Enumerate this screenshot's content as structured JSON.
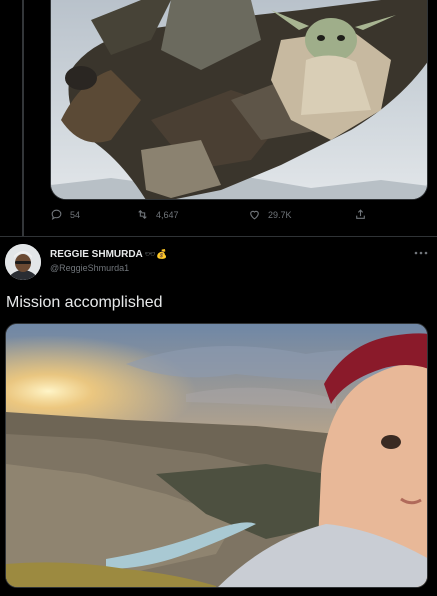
{
  "previous_tweet": {
    "media": {
      "description_icon": "illustration-image"
    },
    "actions": {
      "reply_count": "54",
      "retweet_count": "4,647",
      "like_count": "29.7K"
    }
  },
  "tweet": {
    "author": {
      "display_name": "REGGIE SHMURDA",
      "emojis": "🕶️💰",
      "handle": "@ReggieShmurda1"
    },
    "text": "Mission accomplished",
    "media": {
      "description_icon": "photo-image"
    }
  },
  "colors": {
    "background": "#000000",
    "text_primary": "#e7e9ea",
    "text_secondary": "#71767b",
    "border": "#2f3336"
  }
}
